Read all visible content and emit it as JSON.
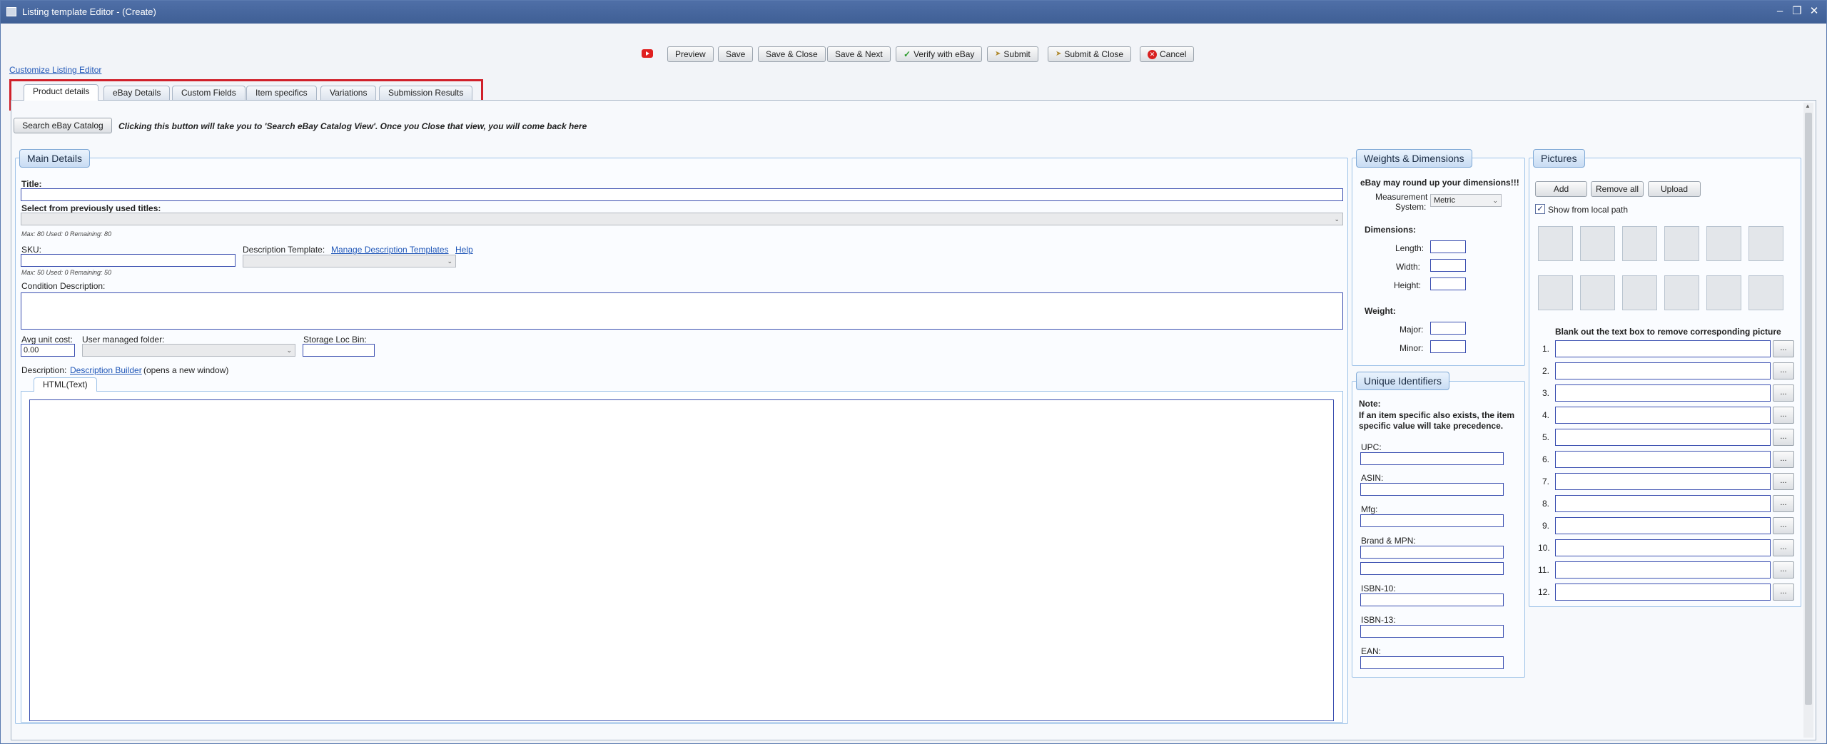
{
  "window": {
    "title": "Listing template Editor - (Create)"
  },
  "toolbar": {
    "preview": "Preview",
    "save": "Save",
    "save_close": "Save & Close",
    "save_next": "Save & Next",
    "verify": "Verify with eBay",
    "submit": "Submit",
    "submit_close": "Submit & Close",
    "cancel": "Cancel"
  },
  "customize_link": "Customize Listing Editor",
  "tabs": [
    "Product details",
    "eBay Details",
    "Custom Fields",
    "Item specifics",
    "Variations",
    "Submission Results"
  ],
  "search_catalog": {
    "button": "Search eBay Catalog",
    "note": "Clicking this button will take you to 'Search eBay Catalog View'. Once you Close that view, you will come back here"
  },
  "main": {
    "header": "Main Details",
    "title_label": "Title:",
    "title_value": "",
    "prev_titles_label": "Select from previously used titles:",
    "title_counter": "Max: 80 Used: 0 Remaining: 80",
    "sku_label": "SKU:",
    "sku_counter": "Max: 50 Used: 0 Remaining: 50",
    "desc_template_label": "Description Template:",
    "manage_templates": "Manage Description Templates",
    "help": "Help",
    "condition_label": "Condition Description:",
    "avg_cost_label": "Avg unit cost:",
    "avg_cost_value": "0.00",
    "folder_label": "User managed folder:",
    "storage_label": "Storage Loc Bin:",
    "description_label": "Description:",
    "description_builder": "Description Builder",
    "description_suffix": "(opens a new window)",
    "html_tab": "HTML(Text)"
  },
  "weights": {
    "header": "Weights & Dimensions",
    "warning": "eBay may round up your dimensions!!!",
    "measure_label_1": "Measurement",
    "measure_label_2": "System:",
    "measure_value": "Metric",
    "dimensions": "Dimensions:",
    "length": "Length:",
    "width": "Width:",
    "height": "Height:",
    "weight": "Weight:",
    "major": "Major:",
    "minor": "Minor:"
  },
  "identifiers": {
    "header": "Unique Identifiers",
    "note": "Note:",
    "note_text_1": "If an item specific also exists, the item",
    "note_text_2": "specific value will take precedence.",
    "upc": "UPC:",
    "asin": "ASIN:",
    "mfg": "Mfg:",
    "brand_mpn": "Brand & MPN:",
    "isbn10": "ISBN-10:",
    "isbn13": "ISBN-13:",
    "ean": "EAN:"
  },
  "pictures": {
    "header": "Pictures",
    "add": "Add",
    "remove_all": "Remove all",
    "upload": "Upload",
    "show_local": "Show from local path",
    "blank_note": "Blank out the text box to remove corresponding picture",
    "rows": [
      "1.",
      "2.",
      "3.",
      "4.",
      "5.",
      "6.",
      "7.",
      "8.",
      "9.",
      "10.",
      "11.",
      "12."
    ],
    "browse": "..."
  },
  "colors": {
    "titlebar": "#4f6fa7",
    "accent_link": "#1f56b7",
    "highlight_box": "#d0202a"
  }
}
